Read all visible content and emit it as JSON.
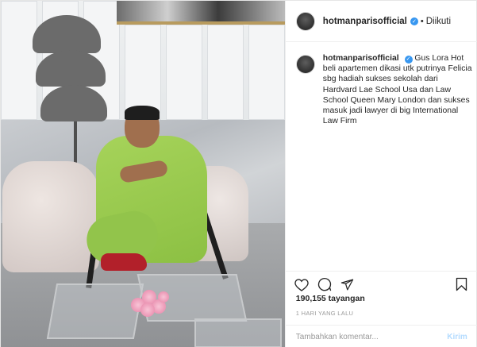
{
  "post": {
    "header": {
      "username": "hotmanparisofficial",
      "verified_icon": "verified-badge-icon",
      "separator": "•",
      "follow_status": "Diikuti"
    },
    "caption": {
      "username": "hotmanparisofficial",
      "text": "Gus Lora Hot beli apartemen dikasi utk putrinya Felicia sbg hadiah sukses sekolah dari Hardvard Lae School Usa dan Law School Queen Mary London dan sukses masuk jadi lawyer di big International Law Firm"
    },
    "actions": {
      "like_icon": "heart-icon",
      "comment_icon": "comment-bubble-icon",
      "share_icon": "paper-plane-icon",
      "save_icon": "bookmark-icon"
    },
    "stats": {
      "views": "190,155 tayangan",
      "time": "1 HARI YANG LALU"
    },
    "comment": {
      "placeholder": "Tambahkan komentar...",
      "post_label": "Kirim"
    },
    "colors": {
      "verified": "#3897f0",
      "suit": "#9bcc4f",
      "post_button_disabled": "#b3dbff"
    }
  }
}
